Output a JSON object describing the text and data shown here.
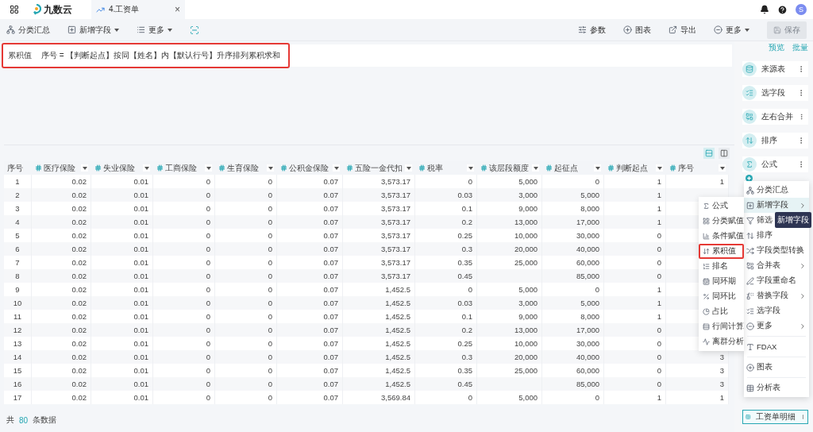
{
  "top_bar": {
    "logo": "九数云",
    "tab": {
      "title": "4.工资单",
      "close": "×"
    },
    "avatar": "S"
  },
  "toolbar": {
    "left": [
      {
        "label": "分类汇总",
        "caret": false
      },
      {
        "label": "新增字段",
        "caret": true
      },
      {
        "label": "更多",
        "caret": true
      }
    ],
    "right": [
      {
        "label": "参数",
        "caret": false
      },
      {
        "label": "图表",
        "caret": false
      },
      {
        "label": "导出",
        "caret": false
      },
      {
        "label": "更多",
        "caret": true
      }
    ],
    "save": {
      "label": "保存",
      "disabled": true
    }
  },
  "formula": {
    "label": "累积值",
    "value": "序号 = 【判断起点】按同【姓名】内【默认行号】升序排列累积求和",
    "highlighted": true
  },
  "table": {
    "columns": [
      {
        "label": "序号",
        "kind": "index"
      },
      {
        "label": "医疗保险",
        "kind": "number"
      },
      {
        "label": "失业保险",
        "kind": "number"
      },
      {
        "label": "工商保险",
        "kind": "number"
      },
      {
        "label": "生育保险",
        "kind": "number"
      },
      {
        "label": "公积金保险",
        "kind": "number"
      },
      {
        "label": "五险一金代扣",
        "kind": "number"
      },
      {
        "label": "税率",
        "kind": "number"
      },
      {
        "label": "该层段额度",
        "kind": "number"
      },
      {
        "label": "起征点",
        "kind": "number"
      },
      {
        "label": "判断起点",
        "kind": "number"
      },
      {
        "label": "序号",
        "kind": "number"
      }
    ],
    "rows": [
      [
        "1",
        "0.02",
        "0.01",
        "0",
        "0",
        "0.07",
        "3,573.17",
        "0",
        "5,000",
        "0",
        "1",
        "1"
      ],
      [
        "2",
        "0.02",
        "0.01",
        "0",
        "0",
        "0.07",
        "3,573.17",
        "0.03",
        "3,000",
        "5,000",
        "1",
        null
      ],
      [
        "3",
        "0.02",
        "0.01",
        "0",
        "0",
        "0.07",
        "3,573.17",
        "0.1",
        "9,000",
        "8,000",
        "1",
        null
      ],
      [
        "4",
        "0.02",
        "0.01",
        "0",
        "0",
        "0.07",
        "3,573.17",
        "0.2",
        "13,000",
        "17,000",
        "1",
        null
      ],
      [
        "5",
        "0.02",
        "0.01",
        "0",
        "0",
        "0.07",
        "3,573.17",
        "0.25",
        "10,000",
        "30,000",
        "0",
        null
      ],
      [
        "6",
        "0.02",
        "0.01",
        "0",
        "0",
        "0.07",
        "3,573.17",
        "0.3",
        "20,000",
        "40,000",
        "0",
        null
      ],
      [
        "7",
        "0.02",
        "0.01",
        "0",
        "0",
        "0.07",
        "3,573.17",
        "0.35",
        "25,000",
        "60,000",
        "0",
        null
      ],
      [
        "8",
        "0.02",
        "0.01",
        "0",
        "0",
        "0.07",
        "3,573.17",
        "0.45",
        null,
        "85,000",
        "0",
        null
      ],
      [
        "9",
        "0.02",
        "0.01",
        "0",
        "0",
        "0.07",
        "1,452.5",
        "0",
        "5,000",
        "0",
        "1",
        null
      ],
      [
        "10",
        "0.02",
        "0.01",
        "0",
        "0",
        "0.07",
        "1,452.5",
        "0.03",
        "3,000",
        "5,000",
        "1",
        null
      ],
      [
        "11",
        "0.02",
        "0.01",
        "0",
        "0",
        "0.07",
        "1,452.5",
        "0.1",
        "9,000",
        "8,000",
        "1",
        null
      ],
      [
        "12",
        "0.02",
        "0.01",
        "0",
        "0",
        "0.07",
        "1,452.5",
        "0.2",
        "13,000",
        "17,000",
        "0",
        null
      ],
      [
        "13",
        "0.02",
        "0.01",
        "0",
        "0",
        "0.07",
        "1,452.5",
        "0.25",
        "10,000",
        "30,000",
        "0",
        null
      ],
      [
        "14",
        "0.02",
        "0.01",
        "0",
        "0",
        "0.07",
        "1,452.5",
        "0.3",
        "20,000",
        "40,000",
        "0",
        "3"
      ],
      [
        "15",
        "0.02",
        "0.01",
        "0",
        "0",
        "0.07",
        "1,452.5",
        "0.35",
        "25,000",
        "60,000",
        "0",
        "3"
      ],
      [
        "16",
        "0.02",
        "0.01",
        "0",
        "0",
        "0.07",
        "1,452.5",
        "0.45",
        null,
        "85,000",
        "0",
        "3"
      ],
      [
        "17",
        "0.02",
        "0.01",
        "0",
        "0",
        "0.07",
        "3,569.84",
        "0",
        "5,000",
        "0",
        "1",
        "1"
      ]
    ]
  },
  "footer": {
    "prefix": "共",
    "count": "80",
    "suffix": "条数据"
  },
  "flow": {
    "links": [
      "预览",
      "批量"
    ],
    "nodes": [
      {
        "label": "来源表"
      },
      {
        "label": "选字段"
      },
      {
        "label": "左右合并"
      },
      {
        "label": "排序"
      },
      {
        "label": "公式"
      }
    ],
    "output": {
      "label": "工资单明细"
    }
  },
  "menu": {
    "groups": [
      [
        {
          "label": "分类汇总",
          "submenu": false,
          "selected": false
        },
        {
          "label": "新增字段",
          "submenu": true,
          "selected": true
        },
        {
          "label": "筛选",
          "submenu": false,
          "selected": false
        },
        {
          "label": "排序",
          "submenu": false,
          "selected": false
        },
        {
          "label": "字段类型转换",
          "submenu": false,
          "selected": false
        },
        {
          "label": "合并表",
          "submenu": true,
          "selected": false
        },
        {
          "label": "字段重命名",
          "submenu": false,
          "selected": false
        },
        {
          "label": "替换字段",
          "submenu": true,
          "selected": false
        },
        {
          "label": "选字段",
          "submenu": false,
          "selected": false
        },
        {
          "label": "更多",
          "submenu": true,
          "selected": false
        }
      ],
      [
        {
          "label": "FDAX",
          "submenu": false,
          "selected": false
        }
      ],
      [
        {
          "label": "图表",
          "submenu": false,
          "selected": false
        }
      ],
      [
        {
          "label": "分析表",
          "submenu": false,
          "selected": false
        }
      ]
    ]
  },
  "tooltip": "新增字段",
  "submenu": {
    "items": [
      {
        "label": "公式",
        "highlighted": false
      },
      {
        "label": "分类赋值",
        "highlighted": false
      },
      {
        "label": "条件赋值",
        "highlighted": false
      },
      {
        "label": "累积值",
        "highlighted": true
      },
      {
        "label": "排名",
        "highlighted": false
      },
      {
        "label": "同环期",
        "highlighted": false
      },
      {
        "label": "同环比",
        "highlighted": false
      },
      {
        "label": "占比",
        "highlighted": false
      },
      {
        "label": "行间计算",
        "highlighted": false
      },
      {
        "label": "离群分析",
        "highlighted": false
      }
    ]
  }
}
